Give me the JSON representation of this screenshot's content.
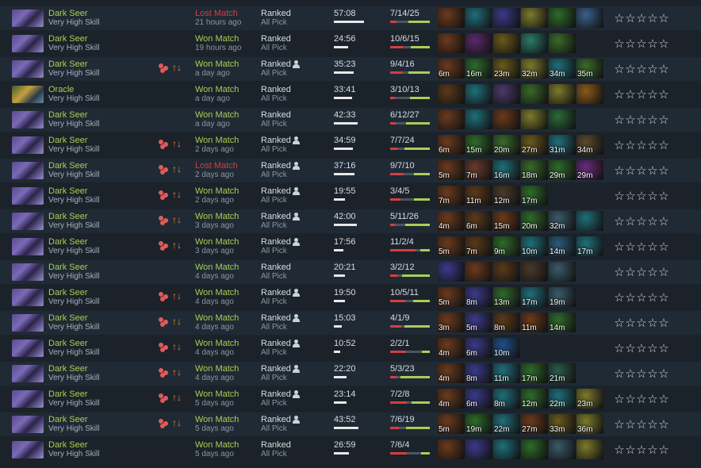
{
  "colors": {
    "won": "#a9cf54",
    "lost": "#d23f3f",
    "hero": "#a9cf54",
    "bg_odd": "#202a34",
    "bg_even": "#1b222a"
  },
  "icons": {
    "party": "party-icon",
    "lane": "lane-arrows-icon",
    "user": "user-icon",
    "star": "star-outline-icon"
  },
  "rating": {
    "max_stars": 5,
    "star_glyph": "☆"
  },
  "matches": [
    {
      "hero": "Dark Seer",
      "hero_pic": "dark-seer",
      "skill": "Very High Skill",
      "party": false,
      "result": "Lost Match",
      "won": false,
      "time": "21 hours ago",
      "lobby": "Ranked",
      "solo": false,
      "mode": "All Pick",
      "duration": "57:08",
      "dur_frac": 0.95,
      "kda": "7/14/25",
      "k": 7,
      "d": 14,
      "a": 25,
      "items": [
        {
          "c": "#6b3a1e",
          "t": ""
        },
        {
          "c": "#1f6f7a",
          "t": ""
        },
        {
          "c": "#3b3a8a",
          "t": ""
        },
        {
          "c": "#7d7a2a",
          "t": ""
        },
        {
          "c": "#2e6b2a",
          "t": ""
        },
        {
          "c": "#3a5f8a",
          "t": ""
        }
      ]
    },
    {
      "hero": "Dark Seer",
      "hero_pic": "dark-seer",
      "skill": "Very High Skill",
      "party": false,
      "result": "Won Match",
      "won": true,
      "time": "19 hours ago",
      "lobby": "Ranked",
      "solo": false,
      "mode": "All Pick",
      "duration": "24:56",
      "dur_frac": 0.45,
      "kda": "10/6/15",
      "k": 10,
      "d": 6,
      "a": 15,
      "items": [
        {
          "c": "#6b3a1e",
          "t": ""
        },
        {
          "c": "#5a2a6a",
          "t": ""
        },
        {
          "c": "#6a5a1a",
          "t": ""
        },
        {
          "c": "#2a7a6a",
          "t": ""
        },
        {
          "c": "#3a6a2a",
          "t": ""
        }
      ]
    },
    {
      "hero": "Dark Seer",
      "hero_pic": "dark-seer",
      "skill": "Very High Skill",
      "party": true,
      "result": "Won Match",
      "won": true,
      "time": "a day ago",
      "lobby": "Ranked",
      "solo": true,
      "mode": "All Pick",
      "duration": "35:23",
      "dur_frac": 0.62,
      "kda": "9/4/16",
      "k": 9,
      "d": 4,
      "a": 16,
      "items": [
        {
          "c": "#6b3a1e",
          "t": "6m"
        },
        {
          "c": "#2e6b2a",
          "t": "16m"
        },
        {
          "c": "#6a5a1a",
          "t": "23m"
        },
        {
          "c": "#7d7a2a",
          "t": "32m"
        },
        {
          "c": "#1f6f7a",
          "t": "34m"
        },
        {
          "c": "#3a6a2a",
          "t": "35m"
        }
      ]
    },
    {
      "hero": "Oracle",
      "hero_pic": "oracle",
      "skill": "Very High Skill",
      "party": false,
      "result": "Won Match",
      "won": true,
      "time": "a day ago",
      "lobby": "Ranked",
      "solo": false,
      "mode": "All Pick",
      "duration": "33:41",
      "dur_frac": 0.58,
      "kda": "3/10/13",
      "k": 3,
      "d": 10,
      "a": 13,
      "items": [
        {
          "c": "#5a3a1a",
          "t": ""
        },
        {
          "c": "#1f6f7a",
          "t": ""
        },
        {
          "c": "#4a3a6a",
          "t": ""
        },
        {
          "c": "#3a6a2a",
          "t": ""
        },
        {
          "c": "#7d7a2a",
          "t": ""
        },
        {
          "c": "#8a5a1a",
          "t": ""
        }
      ]
    },
    {
      "hero": "Dark Seer",
      "hero_pic": "dark-seer",
      "skill": "Very High Skill",
      "party": false,
      "result": "Won Match",
      "won": true,
      "time": "a day ago",
      "lobby": "Ranked",
      "solo": false,
      "mode": "All Pick",
      "duration": "42:33",
      "dur_frac": 0.74,
      "kda": "6/12/27",
      "k": 6,
      "d": 12,
      "a": 27,
      "items": [
        {
          "c": "#6b3a1e",
          "t": ""
        },
        {
          "c": "#1f6f7a",
          "t": ""
        },
        {
          "c": "#6a3a1a",
          "t": ""
        },
        {
          "c": "#7d7a2a",
          "t": ""
        },
        {
          "c": "#2a6a3a",
          "t": ""
        }
      ]
    },
    {
      "hero": "Dark Seer",
      "hero_pic": "dark-seer",
      "skill": "Very High Skill",
      "party": true,
      "result": "Won Match",
      "won": true,
      "time": "2 days ago",
      "lobby": "Ranked",
      "solo": true,
      "mode": "All Pick",
      "duration": "34:59",
      "dur_frac": 0.61,
      "kda": "7/7/24",
      "k": 7,
      "d": 7,
      "a": 24,
      "items": [
        {
          "c": "#6b3a1e",
          "t": "6m"
        },
        {
          "c": "#2e6b2a",
          "t": "15m"
        },
        {
          "c": "#3a6a2a",
          "t": "20m"
        },
        {
          "c": "#6a5a1a",
          "t": "27m"
        },
        {
          "c": "#1f6f7a",
          "t": "31m"
        },
        {
          "c": "#5a4a2a",
          "t": "34m"
        }
      ]
    },
    {
      "hero": "Dark Seer",
      "hero_pic": "dark-seer",
      "skill": "Very High Skill",
      "party": true,
      "result": "Lost Match",
      "won": false,
      "time": "2 days ago",
      "lobby": "Ranked",
      "solo": true,
      "mode": "All Pick",
      "duration": "37:16",
      "dur_frac": 0.65,
      "kda": "9/7/10",
      "k": 9,
      "d": 7,
      "a": 10,
      "items": [
        {
          "c": "#6b3a1e",
          "t": "5m"
        },
        {
          "c": "#6a3a2a",
          "t": "7m"
        },
        {
          "c": "#1f6f7a",
          "t": "16m"
        },
        {
          "c": "#3a6a2a",
          "t": "18m"
        },
        {
          "c": "#2e6b2a",
          "t": "29m"
        },
        {
          "c": "#6a2a7a",
          "t": "29m"
        }
      ]
    },
    {
      "hero": "Dark Seer",
      "hero_pic": "dark-seer",
      "skill": "Very High Skill",
      "party": true,
      "result": "Won Match",
      "won": true,
      "time": "2 days ago",
      "lobby": "Ranked",
      "solo": true,
      "mode": "All Pick",
      "duration": "19:55",
      "dur_frac": 0.35,
      "kda": "3/4/5",
      "k": 3,
      "d": 4,
      "a": 5,
      "items": [
        {
          "c": "#6b3a1e",
          "t": "7m"
        },
        {
          "c": "#5a3a1a",
          "t": "11m"
        },
        {
          "c": "#4a3a2a",
          "t": "12m"
        },
        {
          "c": "#2e6b2a",
          "t": "17m"
        }
      ]
    },
    {
      "hero": "Dark Seer",
      "hero_pic": "dark-seer",
      "skill": "Very High Skill",
      "party": true,
      "result": "Won Match",
      "won": true,
      "time": "3 days ago",
      "lobby": "Ranked",
      "solo": true,
      "mode": "All Pick",
      "duration": "42:00",
      "dur_frac": 0.73,
      "kda": "5/11/26",
      "k": 5,
      "d": 11,
      "a": 26,
      "items": [
        {
          "c": "#6b3a1e",
          "t": "4m"
        },
        {
          "c": "#5a3a1a",
          "t": "6m"
        },
        {
          "c": "#6a3a1a",
          "t": "15m"
        },
        {
          "c": "#2e6b2a",
          "t": "20m"
        },
        {
          "c": "#3a5a6a",
          "t": "32m"
        },
        {
          "c": "#1f6f7a",
          "t": ""
        }
      ]
    },
    {
      "hero": "Dark Seer",
      "hero_pic": "dark-seer",
      "skill": "Very High Skill",
      "party": true,
      "result": "Won Match",
      "won": true,
      "time": "3 days ago",
      "lobby": "Ranked",
      "solo": true,
      "mode": "All Pick",
      "duration": "17:56",
      "dur_frac": 0.31,
      "kda": "11/2/4",
      "k": 11,
      "d": 2,
      "a": 4,
      "items": [
        {
          "c": "#6b3a1e",
          "t": "5m"
        },
        {
          "c": "#5a3a1a",
          "t": "7m"
        },
        {
          "c": "#2e6b2a",
          "t": "9m"
        },
        {
          "c": "#1f6f7a",
          "t": "10m"
        },
        {
          "c": "#2a5a7a",
          "t": "14m"
        },
        {
          "c": "#1f6f7a",
          "t": "17m"
        }
      ]
    },
    {
      "hero": "Dark Seer",
      "hero_pic": "dark-seer",
      "skill": "Very High Skill",
      "party": false,
      "result": "Won Match",
      "won": true,
      "time": "4 days ago",
      "lobby": "Ranked",
      "solo": false,
      "mode": "All Pick",
      "duration": "20:21",
      "dur_frac": 0.36,
      "kda": "3/2/12",
      "k": 3,
      "d": 2,
      "a": 12,
      "items": [
        {
          "c": "#3b3a8a",
          "t": ""
        },
        {
          "c": "#6b3a1e",
          "t": ""
        },
        {
          "c": "#5a3a1a",
          "t": ""
        },
        {
          "c": "#4a3a2a",
          "t": ""
        },
        {
          "c": "#3a5a6a",
          "t": ""
        }
      ]
    },
    {
      "hero": "Dark Seer",
      "hero_pic": "dark-seer",
      "skill": "Very High Skill",
      "party": true,
      "result": "Won Match",
      "won": true,
      "time": "4 days ago",
      "lobby": "Ranked",
      "solo": true,
      "mode": "All Pick",
      "duration": "19:50",
      "dur_frac": 0.35,
      "kda": "10/5/11",
      "k": 10,
      "d": 5,
      "a": 11,
      "items": [
        {
          "c": "#6b3a1e",
          "t": "5m"
        },
        {
          "c": "#3b3a8a",
          "t": "8m"
        },
        {
          "c": "#2e6b2a",
          "t": "13m"
        },
        {
          "c": "#1f6f7a",
          "t": "17m"
        },
        {
          "c": "#3a5a6a",
          "t": "19m"
        }
      ]
    },
    {
      "hero": "Dark Seer",
      "hero_pic": "dark-seer",
      "skill": "Very High Skill",
      "party": true,
      "result": "Won Match",
      "won": true,
      "time": "4 days ago",
      "lobby": "Ranked",
      "solo": true,
      "mode": "All Pick",
      "duration": "15:03",
      "dur_frac": 0.26,
      "kda": "4/1/9",
      "k": 4,
      "d": 1,
      "a": 9,
      "items": [
        {
          "c": "#6b3a1e",
          "t": "3m"
        },
        {
          "c": "#3b3a8a",
          "t": "5m"
        },
        {
          "c": "#5a3a1a",
          "t": "8m"
        },
        {
          "c": "#6a3a1a",
          "t": "11m"
        },
        {
          "c": "#2e6b2a",
          "t": "14m"
        }
      ]
    },
    {
      "hero": "Dark Seer",
      "hero_pic": "dark-seer",
      "skill": "Very High Skill",
      "party": true,
      "result": "Won Match",
      "won": true,
      "time": "4 days ago",
      "lobby": "Ranked",
      "solo": true,
      "mode": "All Pick",
      "duration": "10:52",
      "dur_frac": 0.19,
      "kda": "2/2/1",
      "k": 2,
      "d": 2,
      "a": 1,
      "items": [
        {
          "c": "#6b3a1e",
          "t": "4m"
        },
        {
          "c": "#3b3a8a",
          "t": "6m"
        },
        {
          "c": "#1f4f8a",
          "t": "10m"
        }
      ]
    },
    {
      "hero": "Dark Seer",
      "hero_pic": "dark-seer",
      "skill": "Very High Skill",
      "party": true,
      "result": "Won Match",
      "won": true,
      "time": "4 days ago",
      "lobby": "Ranked",
      "solo": true,
      "mode": "All Pick",
      "duration": "22:20",
      "dur_frac": 0.39,
      "kda": "5/3/23",
      "k": 5,
      "d": 3,
      "a": 23,
      "items": [
        {
          "c": "#6b3a1e",
          "t": "4m"
        },
        {
          "c": "#3b3a8a",
          "t": "8m"
        },
        {
          "c": "#1f6f7a",
          "t": "11m"
        },
        {
          "c": "#2e6b2a",
          "t": "17m"
        },
        {
          "c": "#2a5a4a",
          "t": "21m"
        }
      ]
    },
    {
      "hero": "Dark Seer",
      "hero_pic": "dark-seer",
      "skill": "Very High Skill",
      "party": true,
      "result": "Won Match",
      "won": true,
      "time": "5 days ago",
      "lobby": "Ranked",
      "solo": true,
      "mode": "All Pick",
      "duration": "23:14",
      "dur_frac": 0.41,
      "kda": "7/2/8",
      "k": 7,
      "d": 2,
      "a": 8,
      "items": [
        {
          "c": "#6b3a1e",
          "t": "4m"
        },
        {
          "c": "#3b3a8a",
          "t": "6m"
        },
        {
          "c": "#1f6f7a",
          "t": "8m"
        },
        {
          "c": "#2e6b2a",
          "t": "12m"
        },
        {
          "c": "#1f6f7a",
          "t": "22m"
        },
        {
          "c": "#7d7a2a",
          "t": "23m"
        }
      ]
    },
    {
      "hero": "Dark Seer",
      "hero_pic": "dark-seer",
      "skill": "Very High Skill",
      "party": true,
      "result": "Won Match",
      "won": true,
      "time": "5 days ago",
      "lobby": "Ranked",
      "solo": true,
      "mode": "All Pick",
      "duration": "43:52",
      "dur_frac": 0.77,
      "kda": "7/6/19",
      "k": 7,
      "d": 6,
      "a": 19,
      "items": [
        {
          "c": "#6b3a1e",
          "t": "5m"
        },
        {
          "c": "#2e6b2a",
          "t": "19m"
        },
        {
          "c": "#1f6f7a",
          "t": "22m"
        },
        {
          "c": "#6a3a1a",
          "t": "27m"
        },
        {
          "c": "#6a5a1a",
          "t": "33m"
        },
        {
          "c": "#7d7a2a",
          "t": "36m"
        }
      ]
    },
    {
      "hero": "Dark Seer",
      "hero_pic": "dark-seer",
      "skill": "Very High Skill",
      "party": false,
      "result": "Won Match",
      "won": true,
      "time": "5 days ago",
      "lobby": "Ranked",
      "solo": false,
      "mode": "All Pick",
      "duration": "26:59",
      "dur_frac": 0.47,
      "kda": "7/6/4",
      "k": 7,
      "d": 6,
      "a": 4,
      "items": [
        {
          "c": "#6b3a1e",
          "t": ""
        },
        {
          "c": "#3b3a8a",
          "t": ""
        },
        {
          "c": "#1f6f7a",
          "t": ""
        },
        {
          "c": "#2e6b2a",
          "t": ""
        },
        {
          "c": "#3a5a6a",
          "t": ""
        },
        {
          "c": "#7d7a2a",
          "t": ""
        }
      ]
    }
  ]
}
